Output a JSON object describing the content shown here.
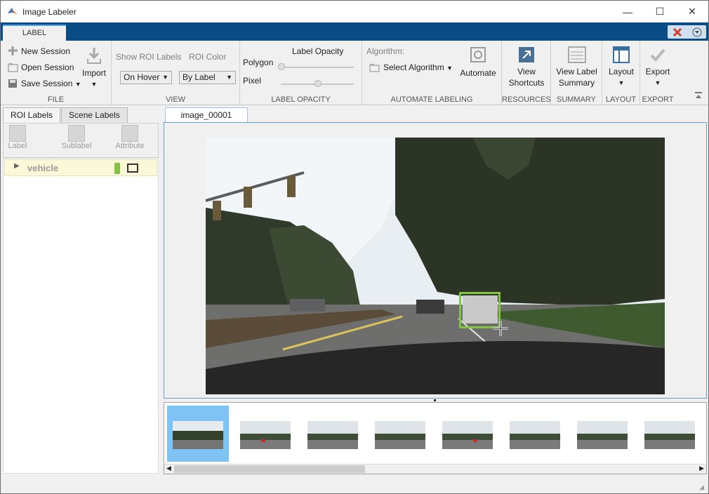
{
  "window": {
    "title": "Image Labeler",
    "minimize": "—",
    "maximize": "☐",
    "close": "✕"
  },
  "tab": {
    "label": "LABEL"
  },
  "file": {
    "new": "New Session",
    "open": "Open Session",
    "save": "Save Session",
    "import": "Import",
    "caption": "FILE"
  },
  "view": {
    "show_roi": "Show ROI Labels",
    "roi_color": "ROI Color",
    "show_value": "On Hover",
    "color_value": "By Label",
    "caption": "VIEW"
  },
  "opacity": {
    "title": "Label Opacity",
    "polygon": "Polygon",
    "pixel": "Pixel",
    "caption": "LABEL OPACITY",
    "polygon_level": 0.0,
    "pixel_level": 0.5
  },
  "automate": {
    "algorithm_label": "Algorithm:",
    "select": "Select Algorithm",
    "automate": "Automate",
    "caption": "AUTOMATE LABELING"
  },
  "resources": {
    "btn_line1": "View",
    "btn_line2": "Shortcuts",
    "caption": "RESOURCES"
  },
  "summary": {
    "btn_line1": "View Label",
    "btn_line2": "Summary",
    "caption": "SUMMARY"
  },
  "layout": {
    "btn": "Layout",
    "caption": "LAYOUT"
  },
  "export": {
    "btn": "Export",
    "caption": "EXPORT"
  },
  "left": {
    "tab_roi": "ROI Labels",
    "tab_scene": "Scene Labels",
    "tool_label": "Label",
    "tool_sublabel": "Sublabel",
    "tool_attribute": "Attribute",
    "label_name": "vehicle",
    "label_color": "#84c445"
  },
  "main": {
    "image_tab": "image_00001"
  },
  "colors": {
    "ribbon_blue": "#0a4d86",
    "selection": "#7fc3f5"
  }
}
